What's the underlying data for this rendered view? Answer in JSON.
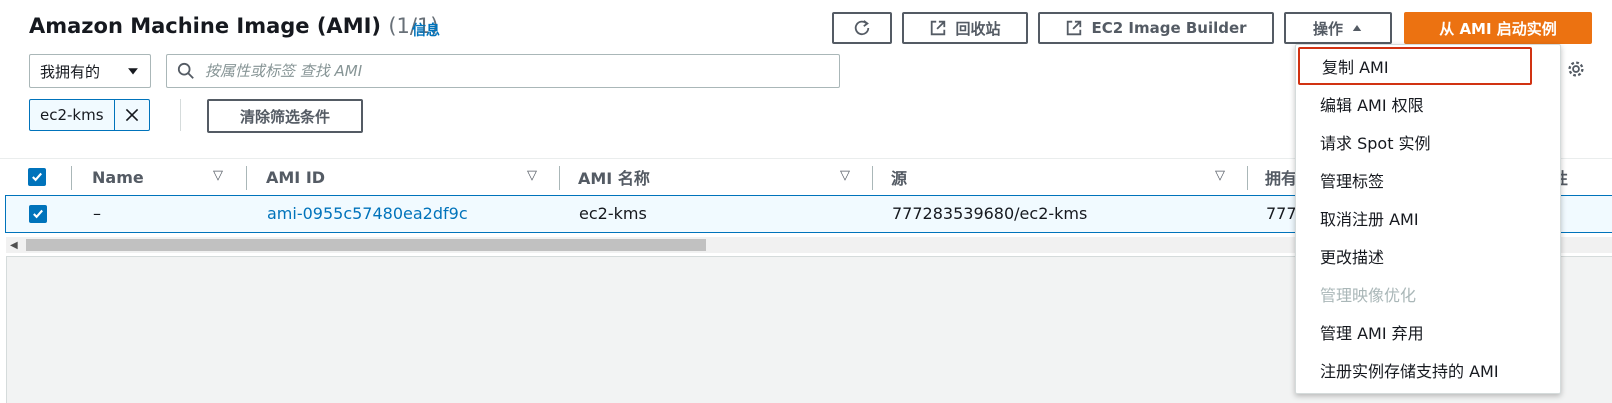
{
  "header": {
    "title": "Amazon Machine Image (AMI)",
    "count": "(1/1)",
    "info": "信息"
  },
  "buttons": {
    "recycle_bin": "回收站",
    "image_builder": "EC2 Image Builder",
    "actions": "操作",
    "launch": "从 AMI 启动实例",
    "clear_filters": "清除筛选条件"
  },
  "filter": {
    "owner_select": "我拥有的",
    "search_placeholder": "按属性或标签 查找 AMI",
    "token": "ec2-kms"
  },
  "table": {
    "columns": [
      "Name",
      "AMI ID",
      "AMI 名称",
      "源",
      "拥有",
      "性"
    ],
    "rows": [
      {
        "name": "–",
        "ami_id": "ami-0955c57480ea2df9c",
        "ami_name": "ec2-kms",
        "source": "777283539680/ec2-kms",
        "owner": "777"
      }
    ]
  },
  "actions_menu": {
    "items": [
      {
        "label": "复制 AMI",
        "disabled": false
      },
      {
        "label": "编辑 AMI 权限",
        "disabled": false
      },
      {
        "label": "请求 Spot 实例",
        "disabled": false
      },
      {
        "label": "管理标签",
        "disabled": false
      },
      {
        "label": "取消注册 AMI",
        "disabled": false
      },
      {
        "label": "更改描述",
        "disabled": false
      },
      {
        "label": "管理映像优化",
        "disabled": true
      },
      {
        "label": "管理 AMI 弃用",
        "disabled": false
      },
      {
        "label": "注册实例存储支持的 AMI",
        "disabled": false
      }
    ]
  },
  "colors": {
    "accent": "#0073bb",
    "primary": "#ec7211",
    "highlight_border": "#d13212"
  }
}
